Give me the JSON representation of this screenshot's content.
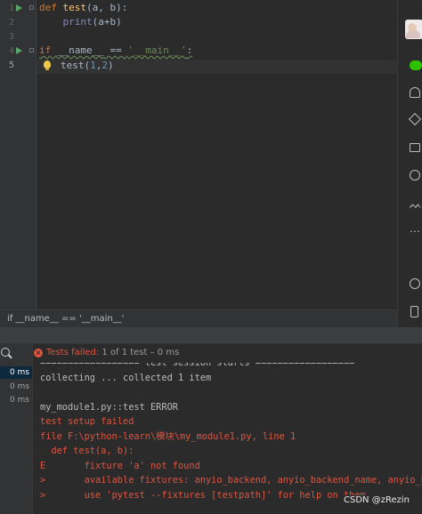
{
  "editor": {
    "line_numbers": [
      "1",
      "2",
      "3",
      "4",
      "5"
    ],
    "code": {
      "l1_def": "def",
      "l1_name": "test",
      "l1_params": "(a, b):",
      "l2_print": "print",
      "l2_args": "(a+b)",
      "l4_if": "if",
      "l4_name": "__name__",
      "l4_eq": " == ",
      "l4_main": "'__main__'",
      "l4_colon": ":",
      "l5_call": "test(",
      "l5_n1": "1",
      "l5_comma": ",",
      "l5_n2": "2",
      "l5_close": ")"
    }
  },
  "breadcrumb": "if __name__ == '__main__'",
  "run": {
    "status_failed": "Tests failed:",
    "status_rest": " 1 of 1 test – 0 ms",
    "times": [
      "0 ms",
      "0 ms",
      "0 ms"
    ],
    "console_lines": [
      "================== test session starts ==================",
      "collecting ... collected 1 item",
      "",
      "my_module1.py::test ERROR",
      "test setup failed",
      "file F:\\python-learn\\模块\\my_module1.py, line 1",
      "  def test(a, b):",
      "E       fixture 'a' not found",
      ">       available fixtures: anyio_backend, anyio_backend_name, anyio_bac",
      ">       use 'pytest --fixtures [testpath]' for help on them."
    ]
  },
  "watermark": "CSDN @zRezin",
  "colors": {
    "background": "#2b2b2b",
    "keyword": "#cc7832",
    "function": "#ffc66d",
    "string": "#6a8759",
    "number": "#6897bb",
    "error": "#e0533f",
    "run_icon": "#59a869"
  },
  "icons": [
    "run-icon",
    "fold-icon",
    "bulb-icon",
    "zoom-icon",
    "error-icon",
    "chat-icon",
    "user-icon",
    "cube-icon",
    "folder-icon",
    "aperture-icon",
    "wave-icon",
    "more-icon",
    "compass-icon",
    "phone-icon",
    "menu-icon"
  ]
}
